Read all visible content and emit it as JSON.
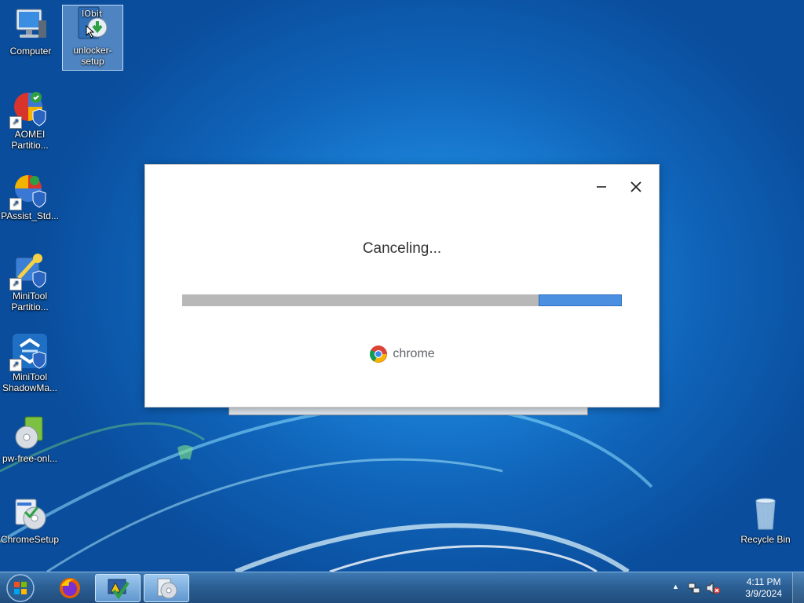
{
  "desktop": {
    "icons": [
      {
        "label": "Computer"
      },
      {
        "label": "unlocker-setup"
      },
      {
        "label": "AOMEI Partitio..."
      },
      {
        "label": "PAssist_Std..."
      },
      {
        "label": "MiniTool Partitio..."
      },
      {
        "label": "MiniTool ShadowMa..."
      },
      {
        "label": "pw-free-onl..."
      },
      {
        "label": "ChromeSetup"
      },
      {
        "label": "Recycle Bin"
      }
    ],
    "unlocker_badge": "IObit"
  },
  "dialog": {
    "status_text": "Canceling...",
    "progress": 0.19,
    "brand_text": "chrome",
    "minimize_symbol": "—",
    "close_symbol": "✕"
  },
  "taskbar": {
    "clock_time": "4:11 PM",
    "clock_date": "3/9/2024",
    "tray_arrow": "▲"
  },
  "colors": {
    "progress_fill": "#4a8fe0",
    "progress_track": "#b8b8b8",
    "desktop_blue": "#1a7fd4"
  }
}
